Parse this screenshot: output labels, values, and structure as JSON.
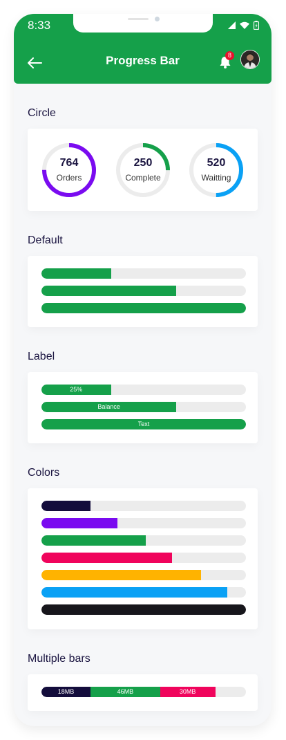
{
  "status_bar": {
    "time": "8:33"
  },
  "appbar": {
    "title": "Progress Bar",
    "notification_count": "8"
  },
  "sections": {
    "circle": "Circle",
    "default": "Default",
    "label": "Label",
    "colors": "Colors",
    "multiple": "Multiple bars"
  },
  "circles": [
    {
      "value": "764",
      "label": "Orders",
      "progress": 0.75,
      "color": "#7a0bf0"
    },
    {
      "value": "250",
      "label": "Complete",
      "progress": 0.25,
      "color": "#15a04a"
    },
    {
      "value": "520",
      "label": "Waitting",
      "progress": 0.5,
      "color": "#0aa1f5"
    }
  ],
  "default_bars": [
    {
      "progress": 0.34,
      "color": "#15a04a"
    },
    {
      "progress": 0.66,
      "color": "#15a04a"
    },
    {
      "progress": 1.0,
      "color": "#15a04a"
    }
  ],
  "label_bars": [
    {
      "progress": 0.34,
      "text": "25%",
      "color": "#15a04a"
    },
    {
      "progress": 0.66,
      "text": "Balance",
      "color": "#15a04a"
    },
    {
      "progress": 1.0,
      "text": "Text",
      "color": "#15a04a"
    }
  ],
  "color_bars": [
    {
      "progress": 0.24,
      "color": "#140d3c"
    },
    {
      "progress": 0.37,
      "color": "#7a0bf0"
    },
    {
      "progress": 0.51,
      "color": "#15a04a"
    },
    {
      "progress": 0.64,
      "color": "#f0045c"
    },
    {
      "progress": 0.78,
      "color": "#ffb300"
    },
    {
      "progress": 0.91,
      "color": "#0aa1f5"
    },
    {
      "progress": 1.0,
      "color": "#17161c"
    }
  ],
  "multiple_bar": [
    {
      "label": "18MB",
      "portion": 0.24,
      "color": "#140d3c"
    },
    {
      "label": "46MB",
      "portion": 0.34,
      "color": "#15a04a"
    },
    {
      "label": "30MB",
      "portion": 0.27,
      "color": "#f0045c"
    }
  ]
}
